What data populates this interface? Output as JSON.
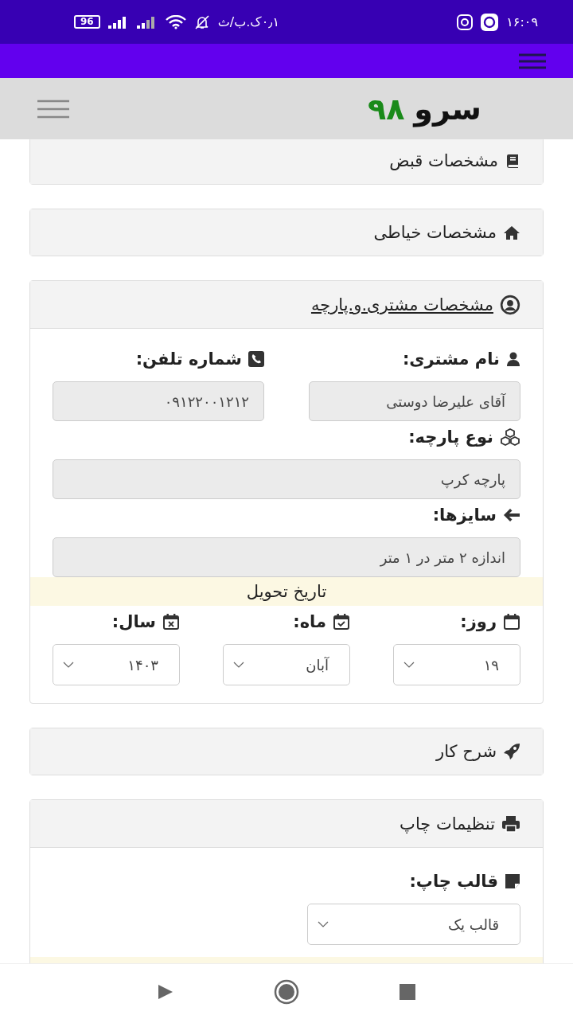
{
  "status_bar": {
    "time": "۱۶:۰۹",
    "speed": "۰٫۱ک.ب/ث",
    "battery": "96"
  },
  "header": {
    "brand": "سرو",
    "brand_number": "۹۸"
  },
  "sections": [
    {
      "title": "مشخصات قبض",
      "underlined": false
    },
    {
      "title": "مشخصات خیاطی",
      "underlined": false
    },
    {
      "title": "مشخصات مشتری.و.پارچه",
      "underlined": true,
      "items": [
        {
          "kind": "pair",
          "fields": [
            {
              "label": "نام مشتری:",
              "value": "آقای علیرضا دوستی"
            },
            {
              "label": "شماره تلفن:",
              "value": "۰۹۱۲۲۰۰۱۲۱۲"
            }
          ]
        },
        {
          "kind": "field",
          "label": "نوع پارچه:",
          "value": "پارچه کرپ"
        },
        {
          "kind": "field",
          "label": "سایزها:",
          "value": "اندازه ۲ متر در ۱ متر"
        },
        {
          "kind": "banner",
          "text": "تاریخ تحویل"
        },
        {
          "kind": "selects",
          "selects": [
            {
              "label": "روز:",
              "value": "۱۹"
            },
            {
              "label": "ماه:",
              "value": "آبان"
            },
            {
              "label": "سال:",
              "value": "۱۴۰۳"
            }
          ]
        }
      ]
    },
    {
      "title": "شرح کار",
      "underlined": false
    },
    {
      "title": "تنظیمات چاپ",
      "underlined": false,
      "items": [
        {
          "kind": "select",
          "label": "قالب چاپ:",
          "value": "قالب یک"
        },
        {
          "kind": "banner"
        }
      ]
    }
  ]
}
